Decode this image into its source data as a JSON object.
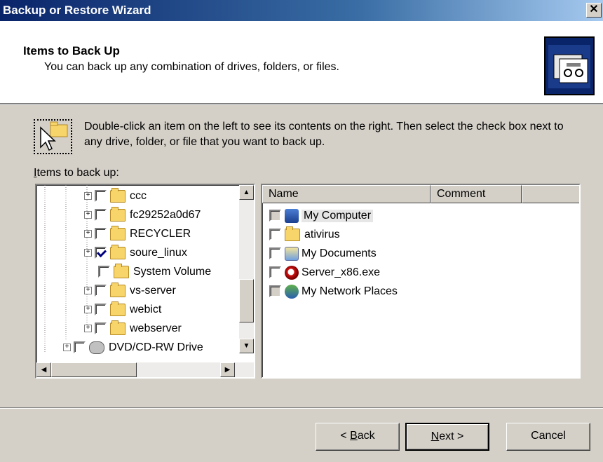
{
  "window": {
    "title": "Backup or Restore Wizard",
    "close_glyph": "✕"
  },
  "header": {
    "title": "Items to Back Up",
    "subtitle": "You can back up any combination of drives, folders, or files."
  },
  "hint": "Double-click an item on the left to see its contents on the right. Then select the check box next to any drive, folder, or file that you want to back up.",
  "items_label": {
    "accel": "I",
    "rest": "tems to back up:"
  },
  "tree": [
    {
      "label": "ccc",
      "expander": "+",
      "checked": false,
      "icon": "folder-icon"
    },
    {
      "label": "fc29252a0d67",
      "expander": "+",
      "checked": false,
      "icon": "folder-icon"
    },
    {
      "label": "RECYCLER",
      "expander": "+",
      "checked": false,
      "icon": "folder-icon"
    },
    {
      "label": "soure_linux",
      "expander": "+",
      "checked": true,
      "icon": "folder-icon"
    },
    {
      "label": "System Volume",
      "expander": "",
      "checked": false,
      "icon": "folder-icon"
    },
    {
      "label": "vs-server",
      "expander": "+",
      "checked": false,
      "icon": "folder-icon"
    },
    {
      "label": "webict",
      "expander": "+",
      "checked": false,
      "icon": "folder-icon"
    },
    {
      "label": "webserver",
      "expander": "+",
      "checked": false,
      "icon": "folder-icon"
    },
    {
      "label": "DVD/CD-RW Drive",
      "expander": "+",
      "checked": false,
      "icon": "drive-icon"
    }
  ],
  "scroll_glyphs": {
    "up": "▲",
    "down": "▼",
    "left": "◀",
    "right": "▶"
  },
  "list": {
    "columns": [
      "Name",
      "Comment"
    ],
    "rows": [
      {
        "label": "My Computer",
        "icon": "computer-icon",
        "check_state": "grey",
        "selected": true
      },
      {
        "label": "ativirus",
        "icon": "folder-icon",
        "check_state": "empty"
      },
      {
        "label": "My Documents",
        "icon": "documents-icon",
        "check_state": "empty"
      },
      {
        "label": "Server_x86.exe",
        "icon": "exe-icon",
        "check_state": "empty"
      },
      {
        "label": "My Network Places",
        "icon": "network-icon",
        "check_state": "grey"
      }
    ]
  },
  "buttons": {
    "back": {
      "prefix": "< ",
      "accel": "B",
      "rest": "ack"
    },
    "next": {
      "accel": "N",
      "rest": "ext >"
    },
    "cancel": "Cancel"
  }
}
